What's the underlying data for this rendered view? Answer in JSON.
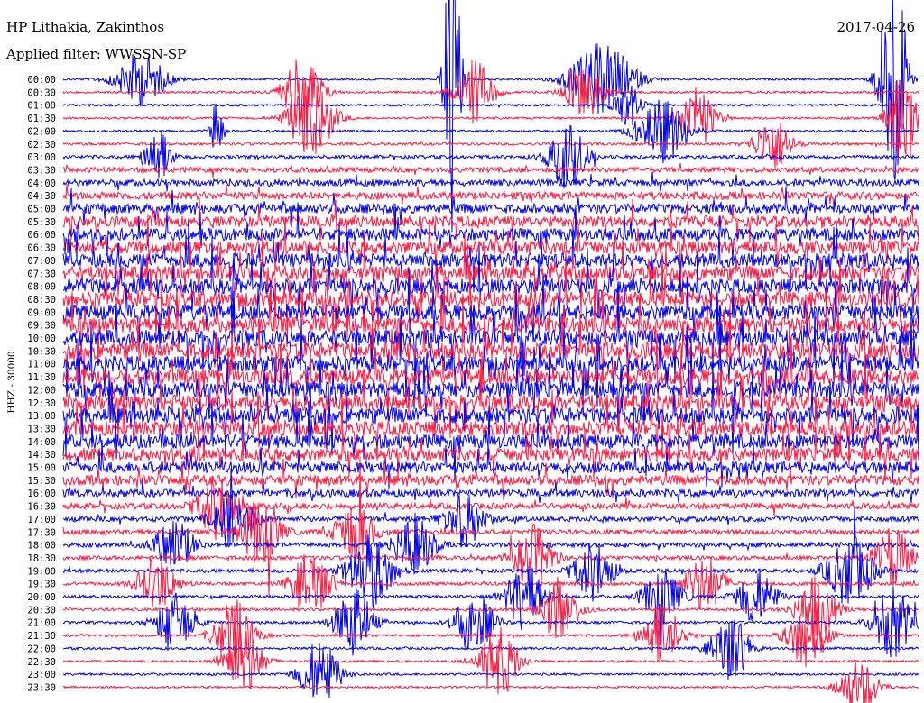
{
  "header": {
    "station": "HP Lithakia, Zakinthos",
    "filter": "Applied filter: WWSSN-SP",
    "date": "2017-04-26"
  },
  "axis": {
    "channel_label": "HHZ - 30000"
  },
  "colors": {
    "trace_a": "#0000ee",
    "trace_b": "#ff1a40",
    "text": "#000000",
    "background": "#ffffff"
  },
  "chart_data": {
    "type": "line",
    "title": "HP Lithakia, Zakinthos",
    "subtitle": "Applied filter: WWSSN-SP",
    "ylabel": "HHZ - 30000",
    "row_labels": [
      "00:00",
      "00:30",
      "01:00",
      "01:30",
      "02:00",
      "02:30",
      "03:00",
      "03:30",
      "04:00",
      "04:30",
      "05:00",
      "05:30",
      "06:00",
      "06:30",
      "07:00",
      "07:30",
      "08:00",
      "08:30",
      "09:00",
      "09:30",
      "10:00",
      "10:30",
      "11:00",
      "11:30",
      "12:00",
      "12:30",
      "13:00",
      "13:30",
      "14:00",
      "14:30",
      "15:00",
      "15:30",
      "16:00",
      "16:30",
      "17:00",
      "17:30",
      "18:00",
      "18:30",
      "19:00",
      "19:30",
      "20:00",
      "20:30",
      "21:00",
      "21:30",
      "22:00",
      "22:30",
      "23:00",
      "23:30"
    ],
    "row_color_pattern": [
      "blue",
      "red"
    ],
    "noise_level": [
      0.25,
      0.3,
      0.3,
      0.3,
      0.3,
      0.35,
      0.45,
      0.7,
      0.9,
      1.0,
      1.25,
      1.45,
      1.6,
      1.75,
      1.85,
      1.9,
      1.95,
      2.0,
      2.05,
      2.05,
      2.1,
      2.1,
      2.1,
      2.1,
      2.1,
      2.05,
      2.0,
      1.95,
      1.85,
      1.7,
      1.5,
      1.3,
      1.0,
      0.8,
      0.7,
      0.65,
      0.6,
      0.55,
      0.5,
      0.45,
      0.42,
      0.4,
      0.38,
      0.35,
      0.33,
      0.3,
      0.3,
      0.28
    ],
    "events": [
      {
        "row": 0,
        "x": 0.09,
        "amp": 1.2,
        "width": 0.04
      },
      {
        "row": 0,
        "x": 0.455,
        "amp": 8,
        "width": 0.012
      },
      {
        "row": 0,
        "x": 0.63,
        "amp": 1.6,
        "width": 0.05
      },
      {
        "row": 0,
        "x": 0.97,
        "amp": 6,
        "width": 0.02
      },
      {
        "row": 1,
        "x": 0.28,
        "amp": 1.8,
        "width": 0.03
      },
      {
        "row": 1,
        "x": 0.48,
        "amp": 1.4,
        "width": 0.03
      },
      {
        "row": 1,
        "x": 0.61,
        "amp": 1.2,
        "width": 0.03
      },
      {
        "row": 2,
        "x": 0.66,
        "amp": 1.0,
        "width": 0.02
      },
      {
        "row": 3,
        "x": 0.29,
        "amp": 1.8,
        "width": 0.035
      },
      {
        "row": 3,
        "x": 0.74,
        "amp": 1.4,
        "width": 0.03
      },
      {
        "row": 3,
        "x": 0.98,
        "amp": 3,
        "width": 0.02
      },
      {
        "row": 4,
        "x": 0.7,
        "amp": 1.4,
        "width": 0.04
      },
      {
        "row": 4,
        "x": 0.18,
        "amp": 1.5,
        "width": 0.01
      },
      {
        "row": 5,
        "x": 0.83,
        "amp": 1.2,
        "width": 0.03
      },
      {
        "row": 6,
        "x": 0.59,
        "amp": 1.4,
        "width": 0.03
      },
      {
        "row": 6,
        "x": 0.11,
        "amp": 1.3,
        "width": 0.02
      },
      {
        "row": 33,
        "x": 0.18,
        "amp": 1.4,
        "width": 0.03
      },
      {
        "row": 34,
        "x": 0.2,
        "amp": 1.3,
        "width": 0.03
      },
      {
        "row": 34,
        "x": 0.47,
        "amp": 1.2,
        "width": 0.03
      },
      {
        "row": 35,
        "x": 0.23,
        "amp": 1.5,
        "width": 0.03
      },
      {
        "row": 35,
        "x": 0.34,
        "amp": 1.3,
        "width": 0.03
      },
      {
        "row": 36,
        "x": 0.41,
        "amp": 1.4,
        "width": 0.03
      },
      {
        "row": 36,
        "x": 0.13,
        "amp": 1.2,
        "width": 0.03
      },
      {
        "row": 37,
        "x": 0.55,
        "amp": 1.4,
        "width": 0.03
      },
      {
        "row": 37,
        "x": 0.97,
        "amp": 1.3,
        "width": 0.03
      },
      {
        "row": 38,
        "x": 0.36,
        "amp": 1.6,
        "width": 0.035
      },
      {
        "row": 38,
        "x": 0.62,
        "amp": 1.3,
        "width": 0.03
      },
      {
        "row": 38,
        "x": 0.92,
        "amp": 1.6,
        "width": 0.035
      },
      {
        "row": 39,
        "x": 0.29,
        "amp": 1.5,
        "width": 0.03
      },
      {
        "row": 39,
        "x": 0.11,
        "amp": 1.2,
        "width": 0.03
      },
      {
        "row": 39,
        "x": 0.75,
        "amp": 1.3,
        "width": 0.03
      },
      {
        "row": 40,
        "x": 0.54,
        "amp": 1.5,
        "width": 0.03
      },
      {
        "row": 40,
        "x": 0.81,
        "amp": 1.3,
        "width": 0.03
      },
      {
        "row": 40,
        "x": 0.7,
        "amp": 1.2,
        "width": 0.03
      },
      {
        "row": 41,
        "x": 0.58,
        "amp": 1.4,
        "width": 0.03
      },
      {
        "row": 41,
        "x": 0.88,
        "amp": 1.5,
        "width": 0.03
      },
      {
        "row": 42,
        "x": 0.34,
        "amp": 1.5,
        "width": 0.03
      },
      {
        "row": 42,
        "x": 0.48,
        "amp": 1.4,
        "width": 0.03
      },
      {
        "row": 42,
        "x": 0.13,
        "amp": 1.3,
        "width": 0.03
      },
      {
        "row": 42,
        "x": 0.97,
        "amp": 1.6,
        "width": 0.03
      },
      {
        "row": 43,
        "x": 0.2,
        "amp": 1.6,
        "width": 0.03
      },
      {
        "row": 43,
        "x": 0.7,
        "amp": 1.4,
        "width": 0.03
      },
      {
        "row": 43,
        "x": 0.87,
        "amp": 1.5,
        "width": 0.03
      },
      {
        "row": 44,
        "x": 0.78,
        "amp": 1.5,
        "width": 0.03
      },
      {
        "row": 45,
        "x": 0.21,
        "amp": 1.6,
        "width": 0.03
      },
      {
        "row": 45,
        "x": 0.51,
        "amp": 1.6,
        "width": 0.03
      },
      {
        "row": 46,
        "x": 0.3,
        "amp": 1.6,
        "width": 0.03
      },
      {
        "row": 47,
        "x": 0.93,
        "amp": 1.3,
        "width": 0.03
      }
    ],
    "grid": false,
    "legend": "none"
  }
}
